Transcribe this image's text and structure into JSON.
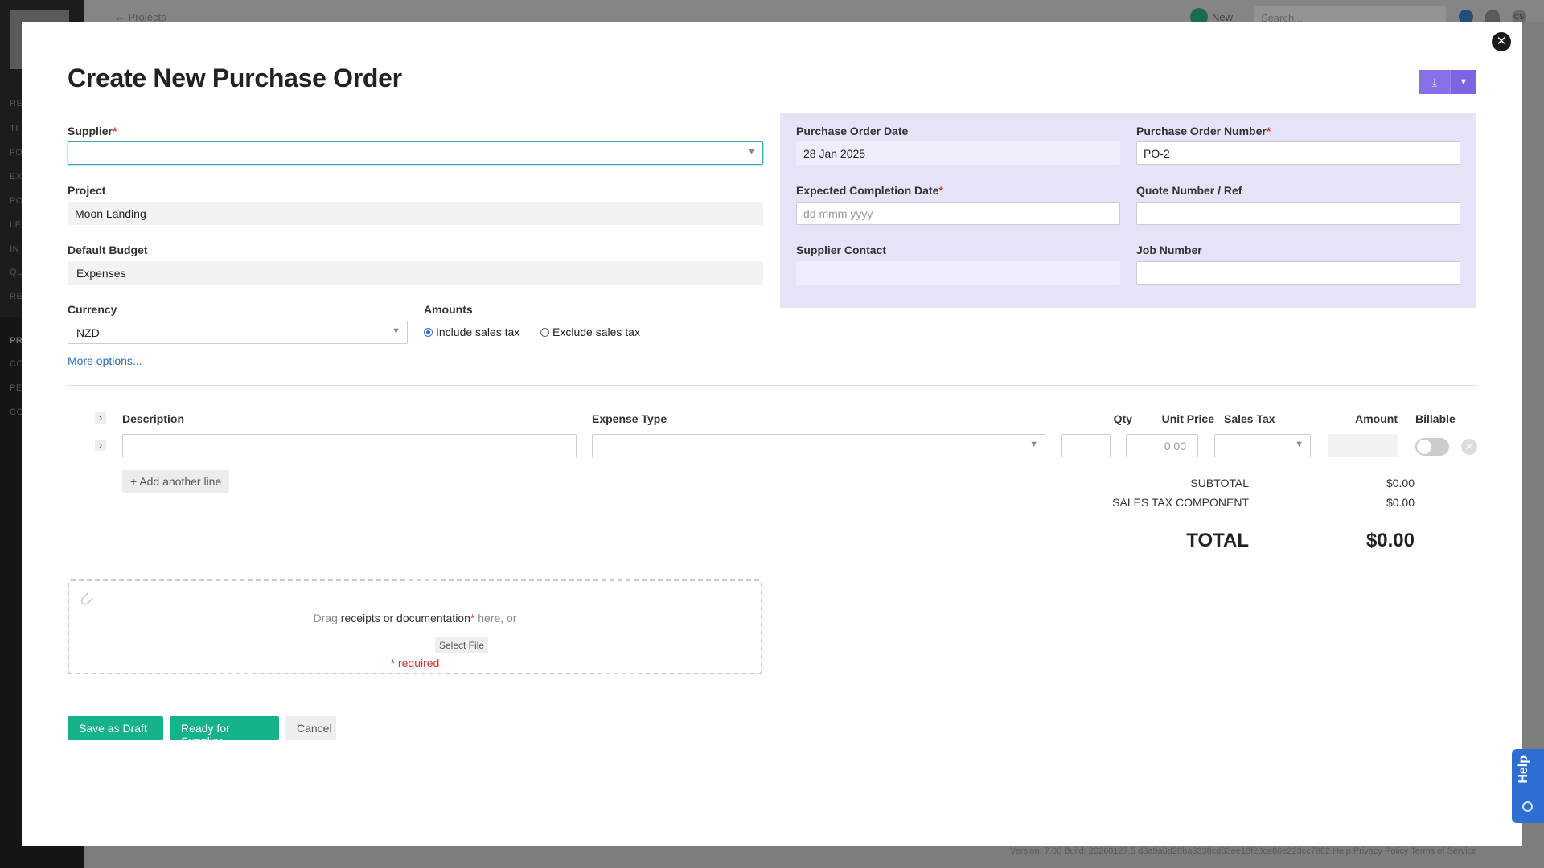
{
  "background": {
    "back_link": "← Projects",
    "new_label": "New",
    "search_placeholder": "Search...",
    "avatar_initials": "CS",
    "nav_items": [
      "RE",
      "TI",
      "FO",
      "EX",
      "PO",
      "LE",
      "IN",
      "QU",
      "RE",
      "PR",
      "CO",
      "PE",
      "CO"
    ],
    "footer": "Version: 7.00   Build: 20260127.5 d8a9a6d28ba3338cd63ee18f20ce86e223cc7982   Help   Privacy Policy   Terms of Service"
  },
  "modal": {
    "title": "Create New Purchase Order",
    "close_glyph": "✕"
  },
  "form": {
    "supplier_label": "Supplier",
    "supplier_value": "",
    "project_label": "Project",
    "project_value": "Moon Landing",
    "budget_label": "Default Budget",
    "budget_value": "Expenses",
    "currency_label": "Currency",
    "currency_value": "NZD",
    "amounts_label": "Amounts",
    "include_tax_label": "Include sales tax",
    "exclude_tax_label": "Exclude sales tax",
    "more_options": "More options...",
    "required_mark": "*"
  },
  "panel": {
    "po_date_label": "Purchase Order Date",
    "po_date_value": "28 Jan 2025",
    "po_number_label": "Purchase Order Number",
    "po_number_value": "PO-2",
    "completion_label": "Expected Completion Date",
    "completion_placeholder": "dd mmm yyyy",
    "quote_label": "Quote Number / Ref",
    "quote_value": "",
    "contact_label": "Supplier Contact",
    "contact_value": "",
    "job_label": "Job Number",
    "job_value": ""
  },
  "lines": {
    "headers": {
      "description": "Description",
      "expense_type": "Expense Type",
      "qty": "Qty",
      "unit_price": "Unit Price",
      "sales_tax": "Sales Tax",
      "amount": "Amount",
      "billable": "Billable"
    },
    "row": {
      "description": "",
      "expense_type": "",
      "qty": "",
      "unit_price_placeholder": "0.00",
      "sales_tax": "",
      "amount": "",
      "billable": false
    },
    "add_line": "+ Add another line"
  },
  "totals": {
    "subtotal_label": "SUBTOTAL",
    "subtotal_value": "$0.00",
    "tax_label": "SALES TAX COMPONENT",
    "tax_value": "$0.00",
    "total_label": "TOTAL",
    "total_value": "$0.00"
  },
  "upload": {
    "drag_prefix": "Drag",
    "drag_strong": "receipts or documentation",
    "drag_suffix": "here, or",
    "select_file": "Select File",
    "required_note": "* required"
  },
  "actions": {
    "save_draft": "Save as Draft",
    "ready_supplier": "Ready for Supplier",
    "cancel": "Cancel"
  },
  "help": {
    "label": "Help"
  },
  "colors": {
    "accent_green": "#16b38a",
    "accent_purple": "#8a70e8",
    "panel_lavender": "#e6e3f8",
    "required_red": "#d33",
    "help_blue": "#2d6fd1"
  }
}
